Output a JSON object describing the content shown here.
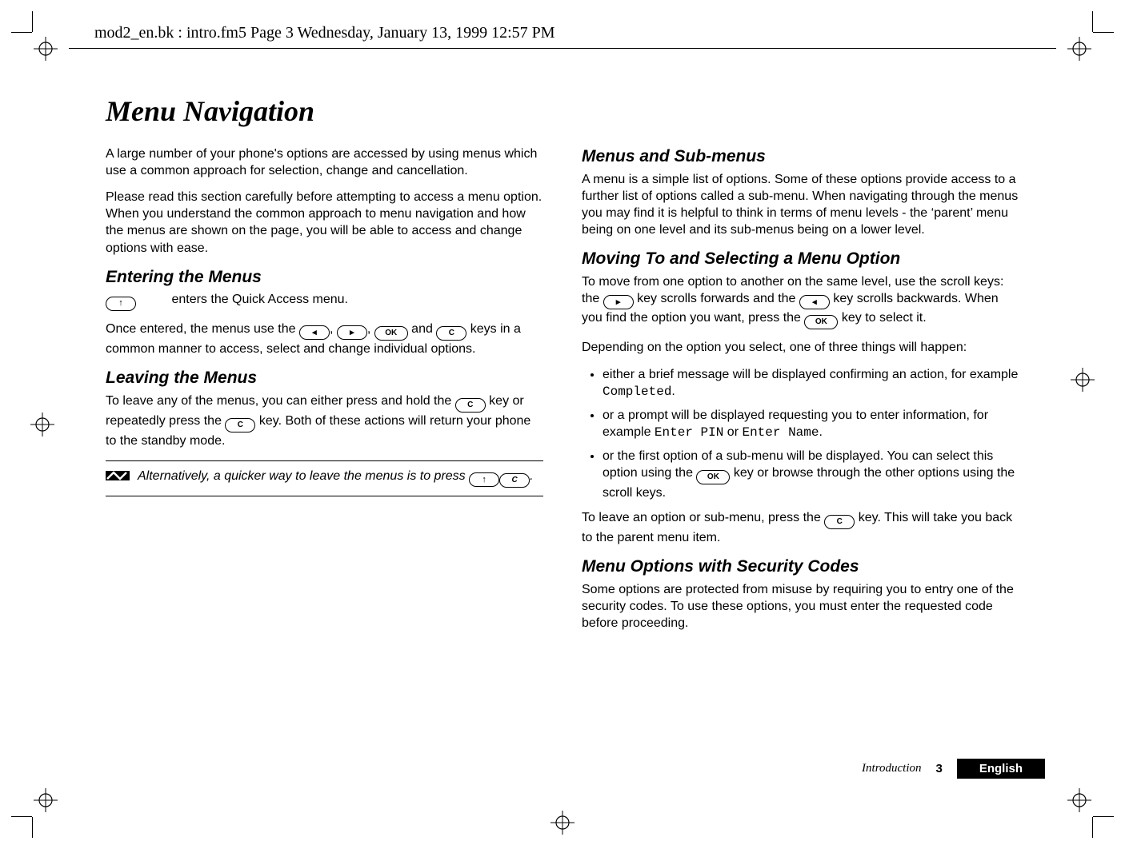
{
  "header_line": "mod2_en.bk : intro.fm5  Page 3  Wednesday, January 13, 1999  12:57 PM",
  "title": "Menu Navigation",
  "left": {
    "p1": "A large number of your phone's options are accessed by using menus which use a common approach for selection, change and cancellation.",
    "p2": "Please read this section carefully before attempting to access a menu option. When you understand the common approach to menu navigation and how the menus are shown on the page, you will be able to access and change options with ease.",
    "h_enter": "Entering the Menus",
    "enter_line_after": "enters the Quick Access menu.",
    "once_a": "Once entered, the menus use the ",
    "once_sep1": ", ",
    "once_sep2": ", ",
    "once_and": " and ",
    "once_b": " keys in a common manner to access, select and change individual options.",
    "h_leave": "Leaving the Menus",
    "leave_a": "To leave any of the menus, you can either press and hold the ",
    "leave_b": " key or repeatedly press the ",
    "leave_c": " key. Both of these actions will return your phone to the standby mode.",
    "note_a": "Alternatively, a quicker way to leave the menus is to press ",
    "note_b": "."
  },
  "right": {
    "h_menus": "Menus and Sub-menus",
    "p_menus": "A menu is a simple list of options. Some of these options provide access to a further list of options called a sub-menu. When navigating through the menus you may find it is helpful to think in terms of menu levels - the ‘parent’ menu being on one level and its sub-menus being on a lower level.",
    "h_move": "Moving To and Selecting a Menu Option",
    "move_a": "To move from one option to another on the same level, use the scroll keys: the ",
    "move_b": " key scrolls forwards and the ",
    "move_c": " key scrolls backwards. When you find the option you want, press the ",
    "move_d": " key to select it.",
    "depending": "Depending on the option you select, one of three things will happen:",
    "li1_a": "either a brief message will be displayed confirming an action, for example ",
    "li1_code": "Completed",
    "li1_b": ".",
    "li2_a": "or a prompt will be displayed requesting you to enter information, for example ",
    "li2_code1": "Enter PIN",
    "li2_or": " or ",
    "li2_code2": "Enter Name",
    "li2_b": ".",
    "li3_a": "or the first option of a sub-menu will be displayed. You can select this option using the ",
    "li3_b": " key or browse through the other options using the scroll keys.",
    "leave_opt_a": "To leave an option or sub-menu, press the ",
    "leave_opt_b": " key. This will take you back to the parent menu item.",
    "h_sec": "Menu Options with Security Codes",
    "p_sec": "Some options are protected from misuse by requiring you to entry one of the security codes. To use these options, you must enter the requested code before proceeding."
  },
  "buttons": {
    "up": "↑",
    "left": "◂",
    "right": "▸",
    "ok": "OK",
    "c": "C"
  },
  "footer": {
    "section": "Introduction",
    "page": "3",
    "lang": "English"
  }
}
